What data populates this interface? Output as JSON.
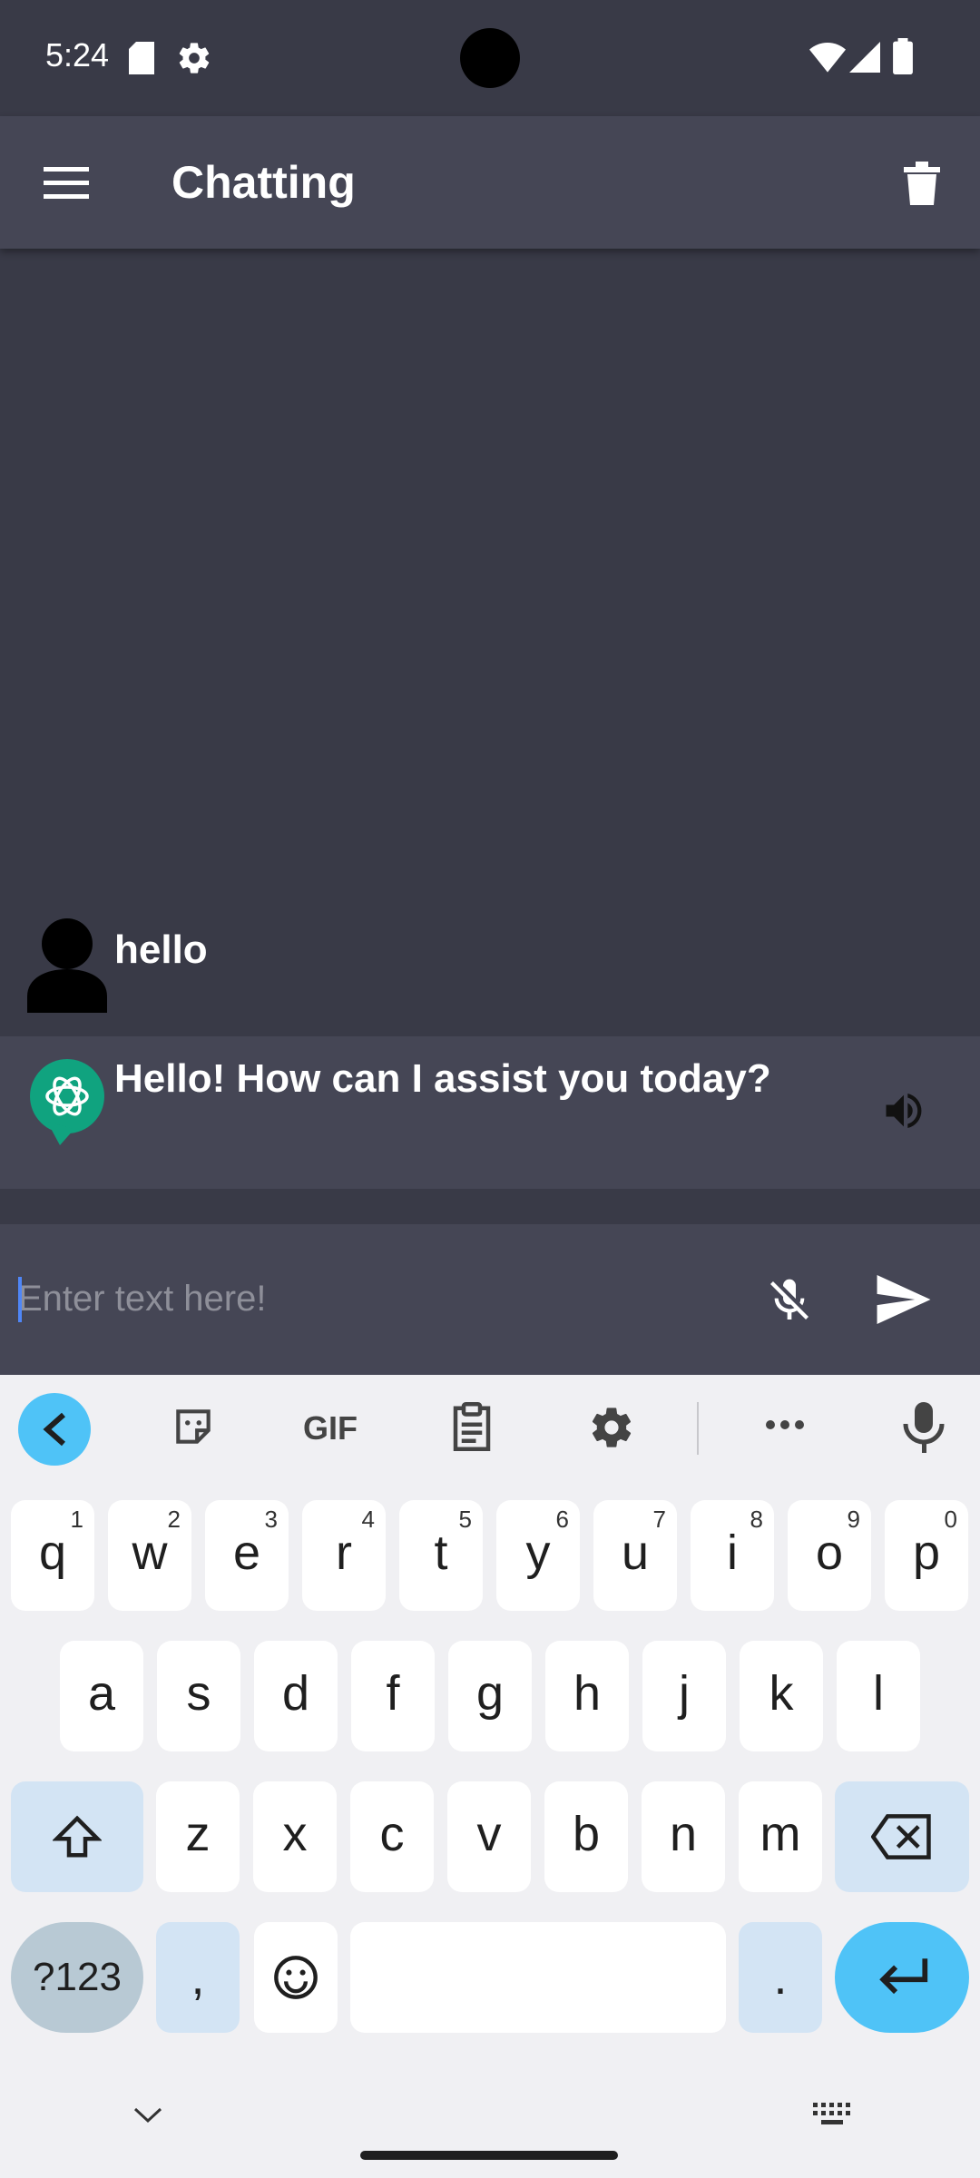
{
  "status_bar": {
    "time": "5:24"
  },
  "app_bar": {
    "title": "Chatting"
  },
  "messages": [
    {
      "role": "user",
      "text": "hello"
    },
    {
      "role": "assistant",
      "text": "Hello! How can I assist you today?"
    }
  ],
  "input": {
    "placeholder": "Enter text here!",
    "value": ""
  },
  "keyboard": {
    "toolbar": {
      "gif_label": "GIF"
    },
    "row1": [
      {
        "key": "q",
        "hint": "1"
      },
      {
        "key": "w",
        "hint": "2"
      },
      {
        "key": "e",
        "hint": "3"
      },
      {
        "key": "r",
        "hint": "4"
      },
      {
        "key": "t",
        "hint": "5"
      },
      {
        "key": "y",
        "hint": "6"
      },
      {
        "key": "u",
        "hint": "7"
      },
      {
        "key": "i",
        "hint": "8"
      },
      {
        "key": "o",
        "hint": "9"
      },
      {
        "key": "p",
        "hint": "0"
      }
    ],
    "row2": [
      "a",
      "s",
      "d",
      "f",
      "g",
      "h",
      "j",
      "k",
      "l"
    ],
    "row3": [
      "z",
      "x",
      "c",
      "v",
      "b",
      "n",
      "m"
    ],
    "row4": {
      "symbols": "?123",
      "comma": ",",
      "period": "."
    }
  },
  "colors": {
    "status_bg": "#393a47",
    "appbar_bg": "#454655",
    "chat_bg": "#393a47",
    "keyboard_bg": "#f0f0f3",
    "accent": "#4fc3f7"
  },
  "icons": {
    "menu": "menu-icon",
    "delete": "trash-icon",
    "user_avatar": "person-icon",
    "bot_avatar": "chatgpt-logo-icon",
    "speaker": "volume-icon",
    "mic_off": "mic-off-icon",
    "send": "send-icon"
  }
}
